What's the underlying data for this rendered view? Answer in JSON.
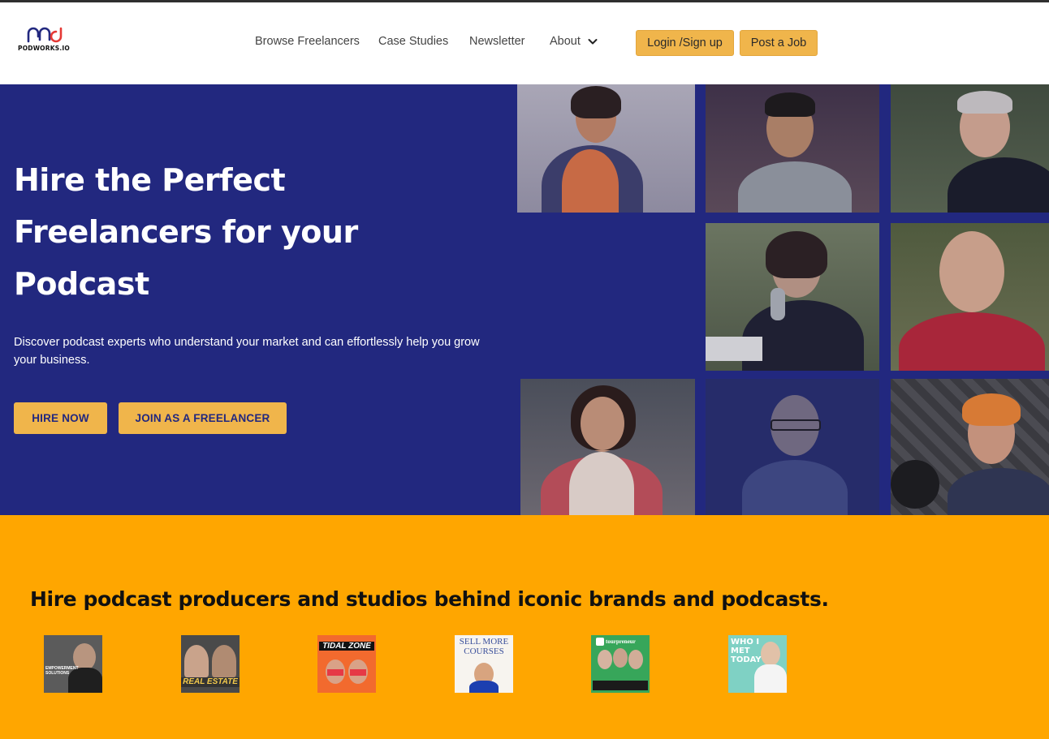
{
  "brand": {
    "logo_text": "PODWORKS.IO",
    "logo_icon": "pnd-logo-icon",
    "accent": "#f0b54b",
    "hero_bg": "#22287f",
    "section_bg": "#ffa600"
  },
  "nav": {
    "items": [
      {
        "label": "Browse Freelancers"
      },
      {
        "label": "Case Studies"
      },
      {
        "label": "Newsletter"
      },
      {
        "label": "About"
      }
    ],
    "about_icon": "chevron-down-icon",
    "login_label": "Login /Sign up",
    "post_label": "Post a Job"
  },
  "hero": {
    "title_lines": [
      "Hire the Perfect",
      "Freelancers for your",
      "Podcast"
    ],
    "subtitle": "Discover podcast experts who understand your market and can effortlessly help you grow your business.",
    "hire_label": "HIRE NOW",
    "join_label": "JOIN AS A FREELANCER"
  },
  "brands": {
    "title": "Hire podcast producers and studios behind iconic brands and podcasts.",
    "covers": [
      {
        "text": "EMPOWERMENT SOLUTIONS"
      },
      {
        "text": "REAL ESTATE"
      },
      {
        "text": "TIDAL ZONE"
      },
      {
        "text": "SELL MORE COURSES"
      },
      {
        "text": "tourpreneur"
      },
      {
        "text": "WHO I MET TODAY"
      }
    ]
  }
}
